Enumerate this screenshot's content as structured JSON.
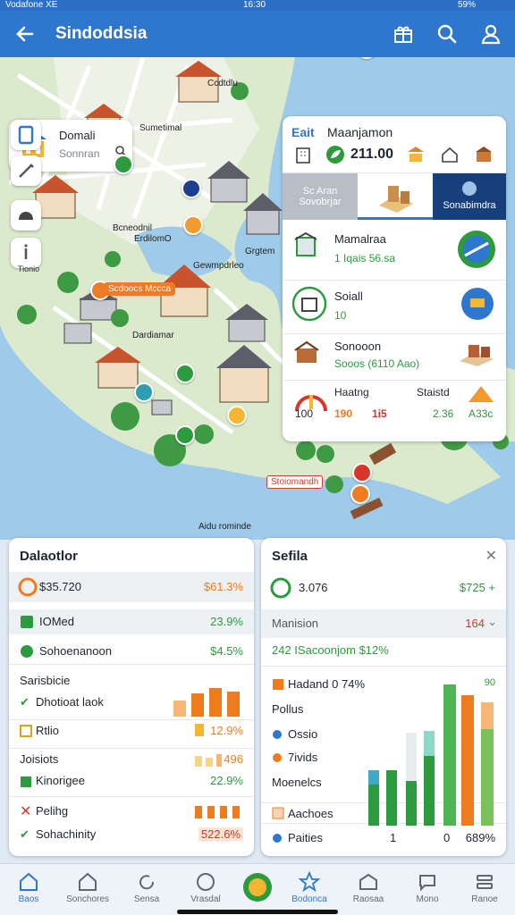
{
  "status": {
    "left": "Vodafone XE",
    "time": "16:30",
    "battery": "59%"
  },
  "appbar": {
    "title": "Sindoddsia"
  },
  "search": {
    "title": "Domali",
    "subtitle": "Sonnran"
  },
  "tools": {
    "label": "Tionio"
  },
  "map": {
    "labels": {
      "a": "Ccdtdlu",
      "b": "Sumetimal",
      "c": "Bcneodnil",
      "d": "ErdilomO",
      "e": "Scdoocs Mccca",
      "f": "Gewmpdrleo",
      "g": "Grgtem",
      "h": "Dardiamar",
      "i": "Stoiomandh",
      "j": "Aidu rominde"
    }
  },
  "info": {
    "header": {
      "kicker": "Eait",
      "title": "Maanjamon",
      "value": "211.00"
    },
    "tabs": [
      {
        "label": "Sc Aran\nSovobrjar"
      },
      {
        "label": ""
      },
      {
        "label": "Sonabimdra"
      }
    ],
    "rows": [
      {
        "title": "Mamalraa",
        "sub": "1 Iqais 56.sa"
      },
      {
        "title": "Soiall",
        "sub": "10"
      },
      {
        "title": "Sonooon",
        "sub": "Sooos (6110 Aao)"
      }
    ],
    "stats": {
      "t1": "Haatng",
      "t2": "Staistd",
      "gauge": "100",
      "v1": "190",
      "v2": "1i5",
      "v3": "2.36",
      "v4": "A33c"
    }
  },
  "left_panel": {
    "title": "Dalaotlor",
    "lines": [
      {
        "k": "$35.720",
        "v": "$61.3%"
      },
      {
        "k": "IOMed",
        "v": "23.9%"
      },
      {
        "k": "Sohoenanoon",
        "v": "$4.5%"
      },
      {
        "k": "Sarisbicie",
        "v": ""
      },
      {
        "k": "Dhotioat laok",
        "v": ""
      },
      {
        "k": "Rtlio",
        "v": "12.9%"
      },
      {
        "k": "Joisiots",
        "v": "496"
      },
      {
        "k": "Kinorigee",
        "v": "22.9%"
      },
      {
        "k": "Pelihg",
        "v": ""
      },
      {
        "k": "Sohachinity",
        "v": "522.6%"
      }
    ]
  },
  "right_panel": {
    "title": "Sefila",
    "lines": [
      {
        "k": "3.076",
        "v": "$725 +"
      },
      {
        "k": "Manision",
        "v": "164"
      },
      {
        "k": "242 ISacoonjom $12%",
        "v": ""
      },
      {
        "k": "Hadand 0 74%",
        "v": "90"
      },
      {
        "k": "Pollus",
        "v": ""
      },
      {
        "k": "Ossio",
        "v": ""
      },
      {
        "k": "7ivids",
        "v": ""
      },
      {
        "k": "Moenelcs",
        "v": ""
      },
      {
        "k": "Aachoes",
        "v": ""
      },
      {
        "k": "Paities",
        "v": "1"
      },
      {
        "k": "0",
        "v": "689%"
      }
    ]
  },
  "nav": [
    {
      "label": "Baos"
    },
    {
      "label": "Sonchores"
    },
    {
      "label": "Sensa"
    },
    {
      "label": "Vrasdal"
    },
    {
      "label": ""
    },
    {
      "label": "Bodonca"
    },
    {
      "label": "Raosaa"
    },
    {
      "label": "Mono"
    },
    {
      "label": "Ranoe"
    }
  ],
  "colors": {
    "primary": "#2f76cf",
    "accent": "#ee7c1e",
    "green": "#2b9b3d",
    "red": "#d8362a"
  }
}
